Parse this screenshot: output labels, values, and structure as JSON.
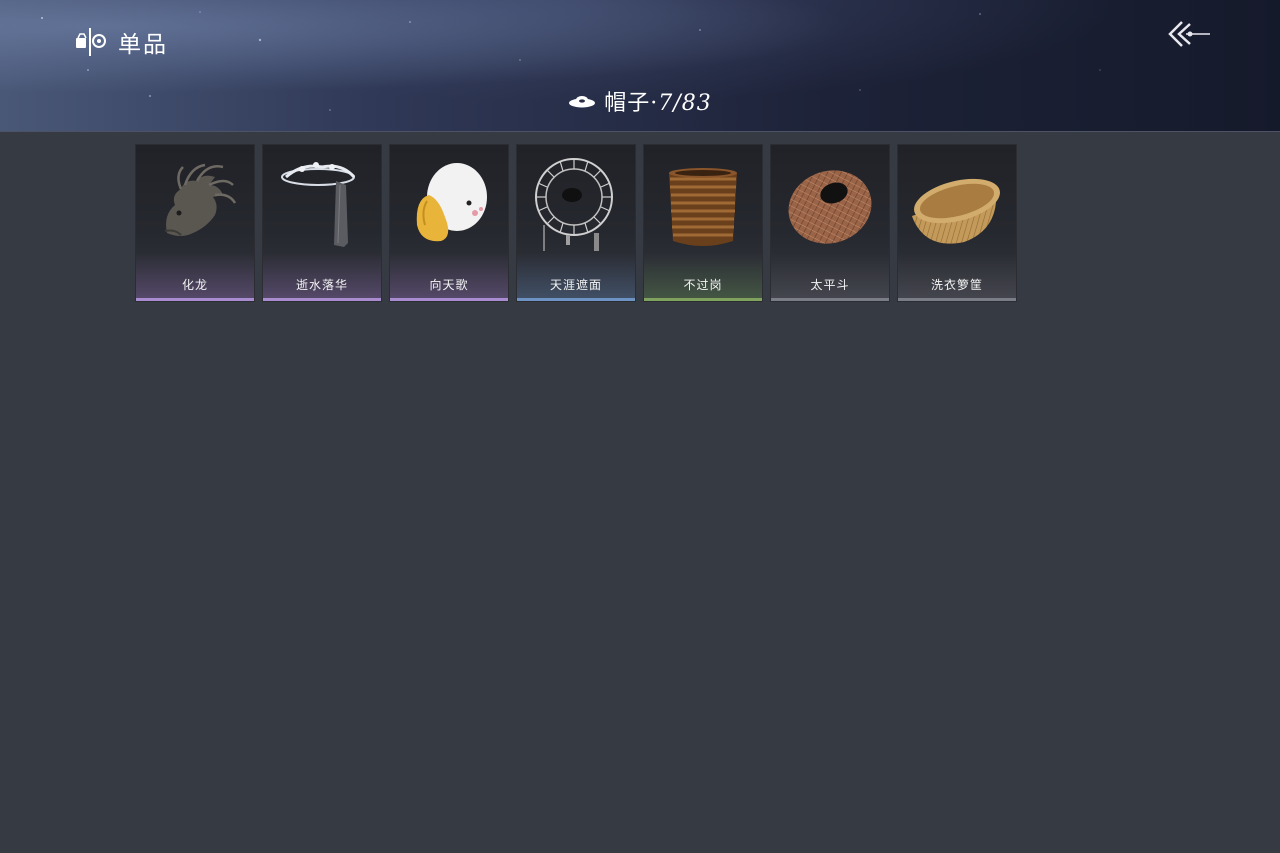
{
  "header": {
    "mode_label": "单品",
    "mode_icon": "item-mode-icon",
    "back_icon": "back-arrow-icon"
  },
  "category": {
    "icon": "hat-icon",
    "name": "帽子",
    "separator": "·",
    "count": "7/83"
  },
  "items": [
    {
      "name": "化龙",
      "icon": "dragon-helmet-icon",
      "quality": "purple"
    },
    {
      "name": "逝水落华",
      "icon": "veil-hat-icon",
      "quality": "purple"
    },
    {
      "name": "向天歌",
      "icon": "goose-hat-icon",
      "quality": "purple"
    },
    {
      "name": "天涯遮面",
      "icon": "woven-frame-hat-icon",
      "quality": "blue"
    },
    {
      "name": "不过岗",
      "icon": "stacked-bowl-hat-icon",
      "quality": "green"
    },
    {
      "name": "太平斗",
      "icon": "bamboo-hat-icon",
      "quality": "plain"
    },
    {
      "name": "洗衣箩筐",
      "icon": "laundry-basket-icon",
      "quality": "plain"
    }
  ],
  "colors": {
    "background": "#363a43",
    "quality_purple": "#a98bd0",
    "quality_blue": "#6c93c4",
    "quality_green": "#7fa25e",
    "quality_plain": "#7b7d86"
  }
}
